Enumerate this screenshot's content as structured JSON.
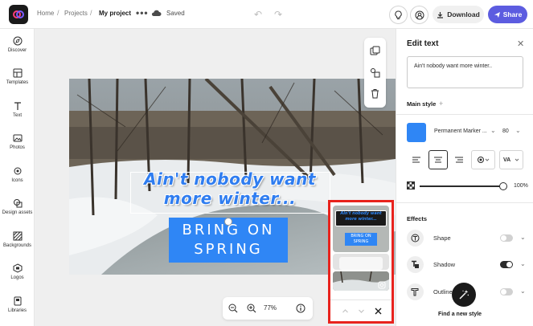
{
  "header": {
    "breadcrumb": [
      "Home",
      "Projects",
      "My project"
    ],
    "more_label": "•••",
    "saved_label": "Saved",
    "download_label": "Download",
    "share_label": "Share"
  },
  "sidebar": {
    "items": [
      {
        "label": "Discover",
        "icon": "compass-icon"
      },
      {
        "label": "Templates",
        "icon": "templates-icon"
      },
      {
        "label": "Text",
        "icon": "text-icon"
      },
      {
        "label": "Photos",
        "icon": "photos-icon"
      },
      {
        "label": "Icons",
        "icon": "icons-icon"
      },
      {
        "label": "Design assets",
        "icon": "design-assets-icon"
      },
      {
        "label": "Backgrounds",
        "icon": "backgrounds-icon"
      },
      {
        "label": "Logos",
        "icon": "logos-icon"
      },
      {
        "label": "Libraries",
        "icon": "libraries-icon"
      }
    ]
  },
  "canvas": {
    "headline": "Ain't nobody want more winter...",
    "subline": "BRING ON SPRING",
    "zoom": "77%"
  },
  "style_picker": {
    "thumb_1_headline": "Ain't nobody want more winter...",
    "thumb_1_subline": "BRING ON SPRING"
  },
  "panel": {
    "title": "Edit text",
    "text_value": "Ain't nobody want more winter..",
    "main_style_label": "Main style",
    "font_name": "Permanent Marker ...",
    "font_size": "80",
    "opacity": "100%",
    "effects_label": "Effects",
    "effects": [
      {
        "label": "Shape",
        "on": false
      },
      {
        "label": "Shadow",
        "on": true
      },
      {
        "label": "Outline",
        "on": false
      }
    ],
    "find_style_label": "Find a new style"
  },
  "colors": {
    "accent": "#5c5ce0",
    "text_blue": "#2f86f5",
    "picker_highlight": "#e8231d"
  }
}
